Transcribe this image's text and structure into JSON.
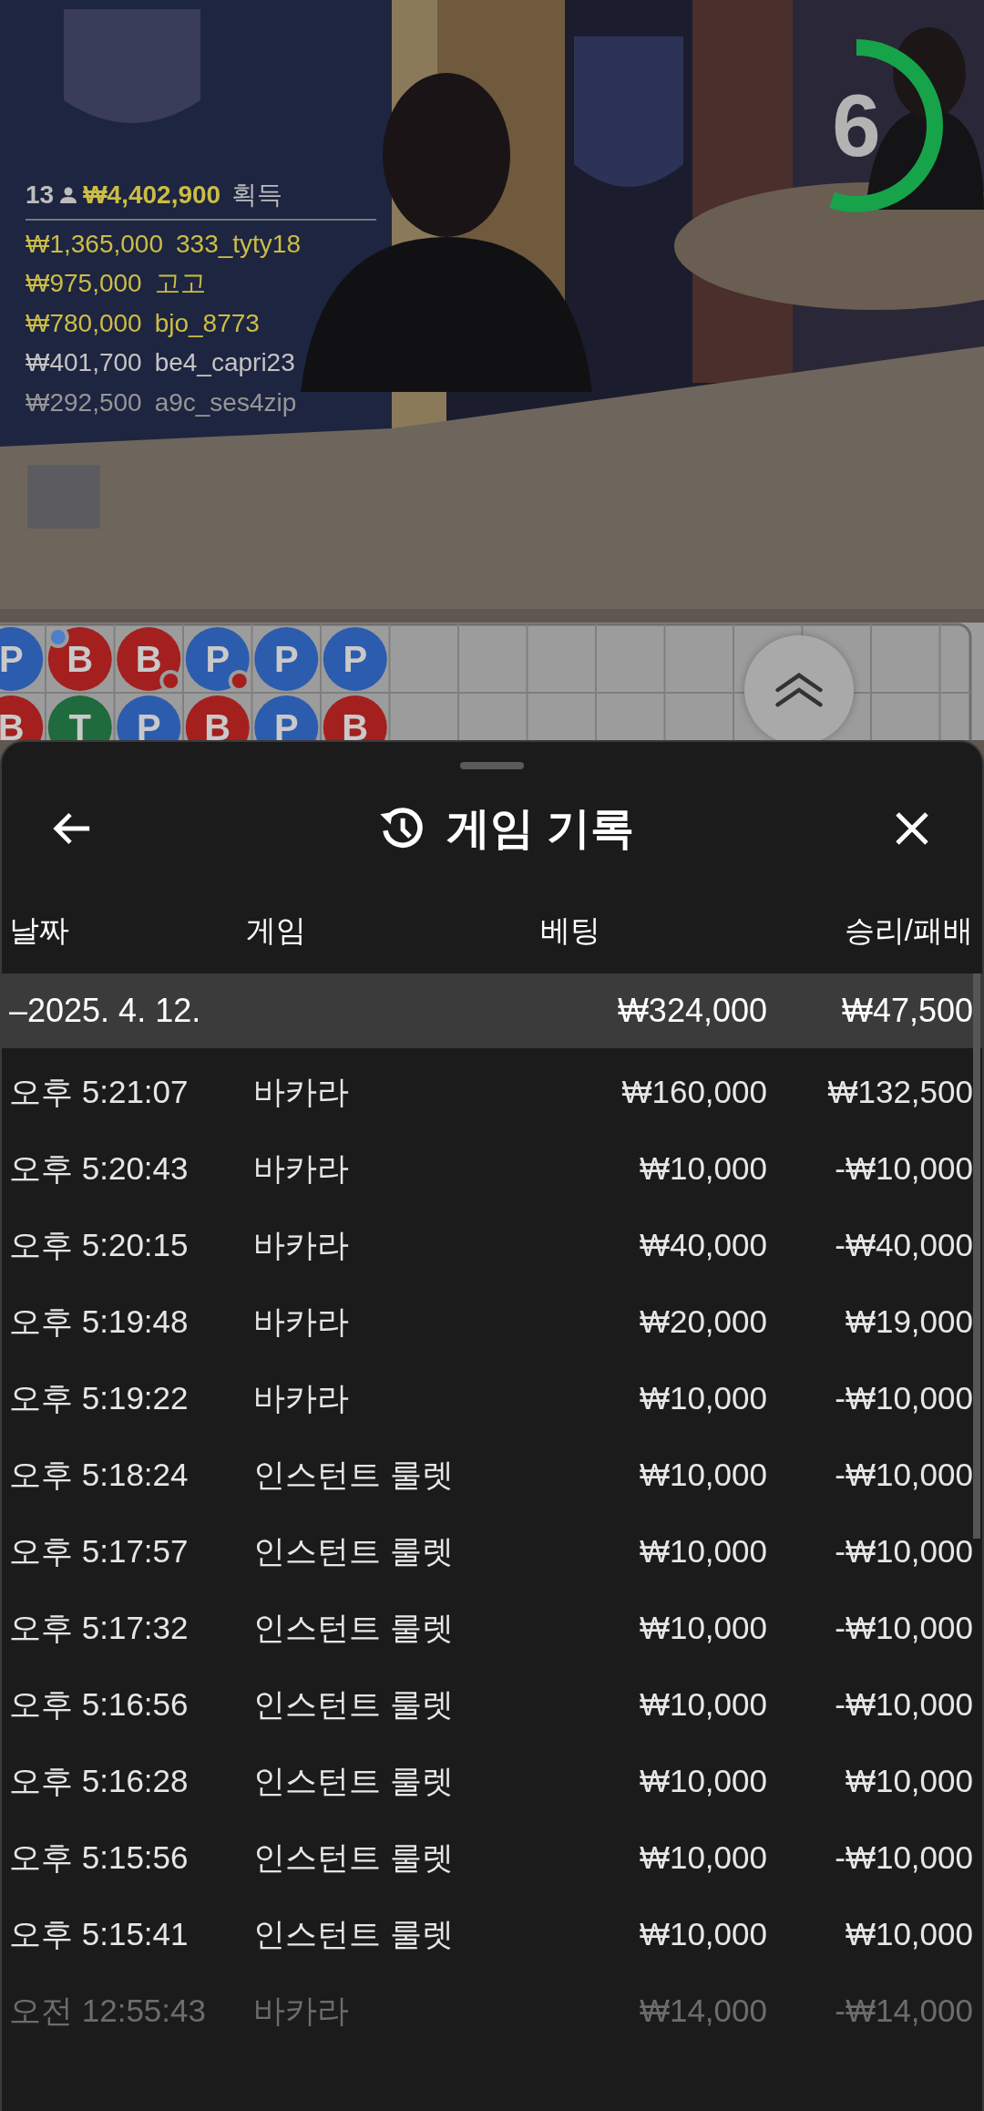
{
  "winners": {
    "player_count": "13",
    "total": "₩4,402,900",
    "label": "획득",
    "entries": [
      {
        "amount": "₩1,365,000",
        "name": "333_tyty18",
        "highlighted": true,
        "dimmed": false
      },
      {
        "amount": "₩975,000",
        "name": "고고",
        "highlighted": true,
        "dimmed": false
      },
      {
        "amount": "₩780,000",
        "name": "bjo_8773",
        "highlighted": true,
        "dimmed": false
      },
      {
        "amount": "₩401,700",
        "name": "be4_capri23",
        "highlighted": false,
        "dimmed": false
      },
      {
        "amount": "₩292,500",
        "name": "a9c_ses4zip",
        "highlighted": false,
        "dimmed": true
      }
    ]
  },
  "timer": {
    "count": "6",
    "level": 0.55
  },
  "bead_road": {
    "columns": [
      [
        {
          "letter": "P",
          "color": "#2c5cae"
        },
        {
          "letter": "B",
          "color": "#a3201f"
        }
      ],
      [
        {
          "letter": "B",
          "color": "#a3201f",
          "dot": {
            "kind": "player_pair"
          }
        },
        {
          "letter": "T",
          "color": "#1f6b3d"
        }
      ],
      [
        {
          "letter": "B",
          "color": "#a3201f",
          "dot": {
            "kind": "banker_pair"
          }
        },
        {
          "letter": "P",
          "color": "#2c5cae"
        }
      ],
      [
        {
          "letter": "P",
          "color": "#2c5cae",
          "dot": {
            "kind": "banker_pair"
          }
        },
        {
          "letter": "B",
          "color": "#a3201f"
        }
      ],
      [
        {
          "letter": "P",
          "color": "#2c5cae"
        },
        {
          "letter": "P",
          "color": "#2c5cae"
        }
      ],
      [
        {
          "letter": "P",
          "color": "#2c5cae"
        },
        {
          "letter": "B",
          "color": "#a3201f"
        }
      ]
    ]
  },
  "history": {
    "title": "게임 기록",
    "columns": [
      "날짜",
      "게임",
      "베팅",
      "승리/패배"
    ],
    "summary": {
      "date": "–2025. 4. 12.",
      "bet": "₩324,000",
      "result": "₩47,500"
    },
    "rows": [
      {
        "time": "오후 5:21:07",
        "game": "바카라",
        "bet": "₩160,000",
        "result": "₩132,500",
        "dimmed": false
      },
      {
        "time": "오후 5:20:43",
        "game": "바카라",
        "bet": "₩10,000",
        "result": "-₩10,000",
        "dimmed": false
      },
      {
        "time": "오후 5:20:15",
        "game": "바카라",
        "bet": "₩40,000",
        "result": "-₩40,000",
        "dimmed": false
      },
      {
        "time": "오후 5:19:48",
        "game": "바카라",
        "bet": "₩20,000",
        "result": "₩19,000",
        "dimmed": false
      },
      {
        "time": "오후 5:19:22",
        "game": "바카라",
        "bet": "₩10,000",
        "result": "-₩10,000",
        "dimmed": false
      },
      {
        "time": "오후 5:18:24",
        "game": "인스턴트 룰렛",
        "bet": "₩10,000",
        "result": "-₩10,000",
        "dimmed": false
      },
      {
        "time": "오후 5:17:57",
        "game": "인스턴트 룰렛",
        "bet": "₩10,000",
        "result": "-₩10,000",
        "dimmed": false
      },
      {
        "time": "오후 5:17:32",
        "game": "인스턴트 룰렛",
        "bet": "₩10,000",
        "result": "-₩10,000",
        "dimmed": false
      },
      {
        "time": "오후 5:16:56",
        "game": "인스턴트 룰렛",
        "bet": "₩10,000",
        "result": "-₩10,000",
        "dimmed": false
      },
      {
        "time": "오후 5:16:28",
        "game": "인스턴트 룰렛",
        "bet": "₩10,000",
        "result": "₩10,000",
        "dimmed": false
      },
      {
        "time": "오후 5:15:56",
        "game": "인스턴트 룰렛",
        "bet": "₩10,000",
        "result": "-₩10,000",
        "dimmed": false
      },
      {
        "time": "오후 5:15:41",
        "game": "인스턴트 룰렛",
        "bet": "₩10,000",
        "result": "₩10,000",
        "dimmed": false
      },
      {
        "time": "오전 12:55:43",
        "game": "바카라",
        "bet": "₩14,000",
        "result": "-₩14,000",
        "dimmed": true
      }
    ]
  }
}
